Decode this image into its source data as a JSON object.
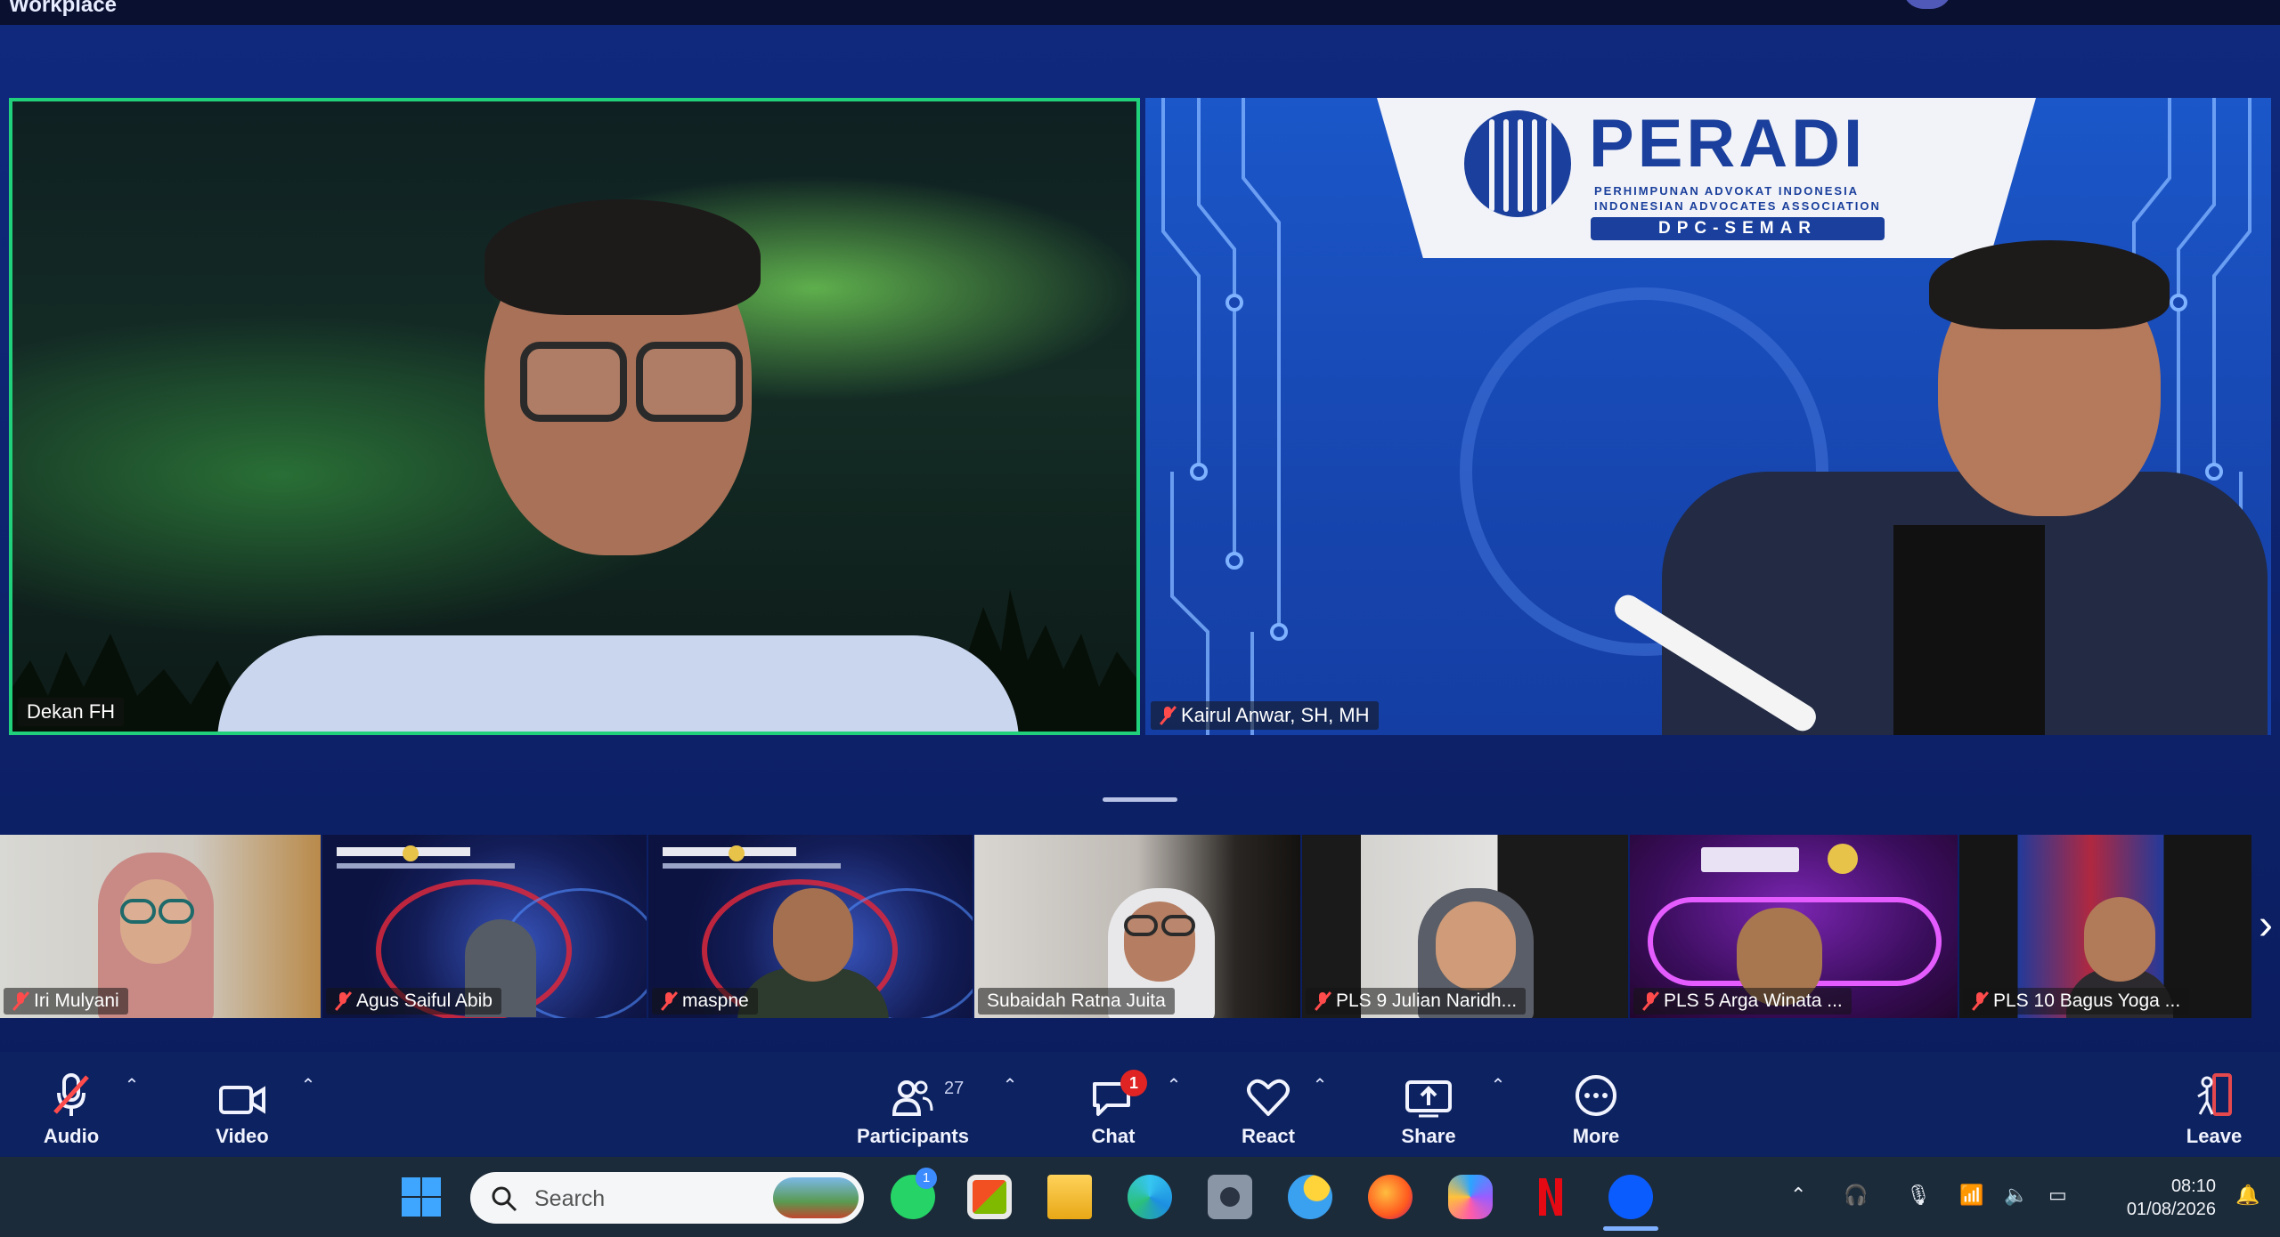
{
  "window": {
    "title": "Workplace"
  },
  "main_tiles": [
    {
      "name": "Dekan FH",
      "muted": false,
      "active_speaker": true
    },
    {
      "name": "Kairul Anwar, SH, MH",
      "muted": true,
      "active_speaker": false
    }
  ],
  "peradi_banner": {
    "wordmark": "PERADI",
    "subtitle_1": "PERHIMPUNAN ADVOKAT INDONESIA",
    "subtitle_2": "INDONESIAN ADVOCATES ASSOCIATION",
    "branch": "DPC-SEMAR"
  },
  "gallery": [
    {
      "name": "Iri Mulyani",
      "muted": true
    },
    {
      "name": "Agus Saiful Abib",
      "muted": true
    },
    {
      "name": "maspne",
      "muted": true
    },
    {
      "name": "Subaidah Ratna Juita",
      "muted": false
    },
    {
      "name": "PLS 9 Julian Naridh...",
      "muted": true
    },
    {
      "name": "PLS 5 Arga Winata ...",
      "muted": true
    },
    {
      "name": "PLS 10 Bagus Yoga ...",
      "muted": true
    }
  ],
  "gallery_next_icon": "chevron-right-icon",
  "toolbar": {
    "audio_label": "Audio",
    "video_label": "Video",
    "participants_label": "Participants",
    "participants_count": "27",
    "chat_label": "Chat",
    "chat_badge": "1",
    "react_label": "React",
    "share_label": "Share",
    "more_label": "More",
    "leave_label": "Leave",
    "leave_color": "#e5484d",
    "mute_color": "#ff4b4b"
  },
  "taskbar": {
    "search_placeholder": "Search",
    "time": "08:10",
    "date": "01/08/2026",
    "whatsapp_badge": "1",
    "apps": [
      "windows-start",
      "whatsapp",
      "microsoft-store",
      "file-explorer",
      "edge",
      "camera",
      "weather",
      "firefox",
      "copilot",
      "netflix",
      "zoom"
    ]
  }
}
